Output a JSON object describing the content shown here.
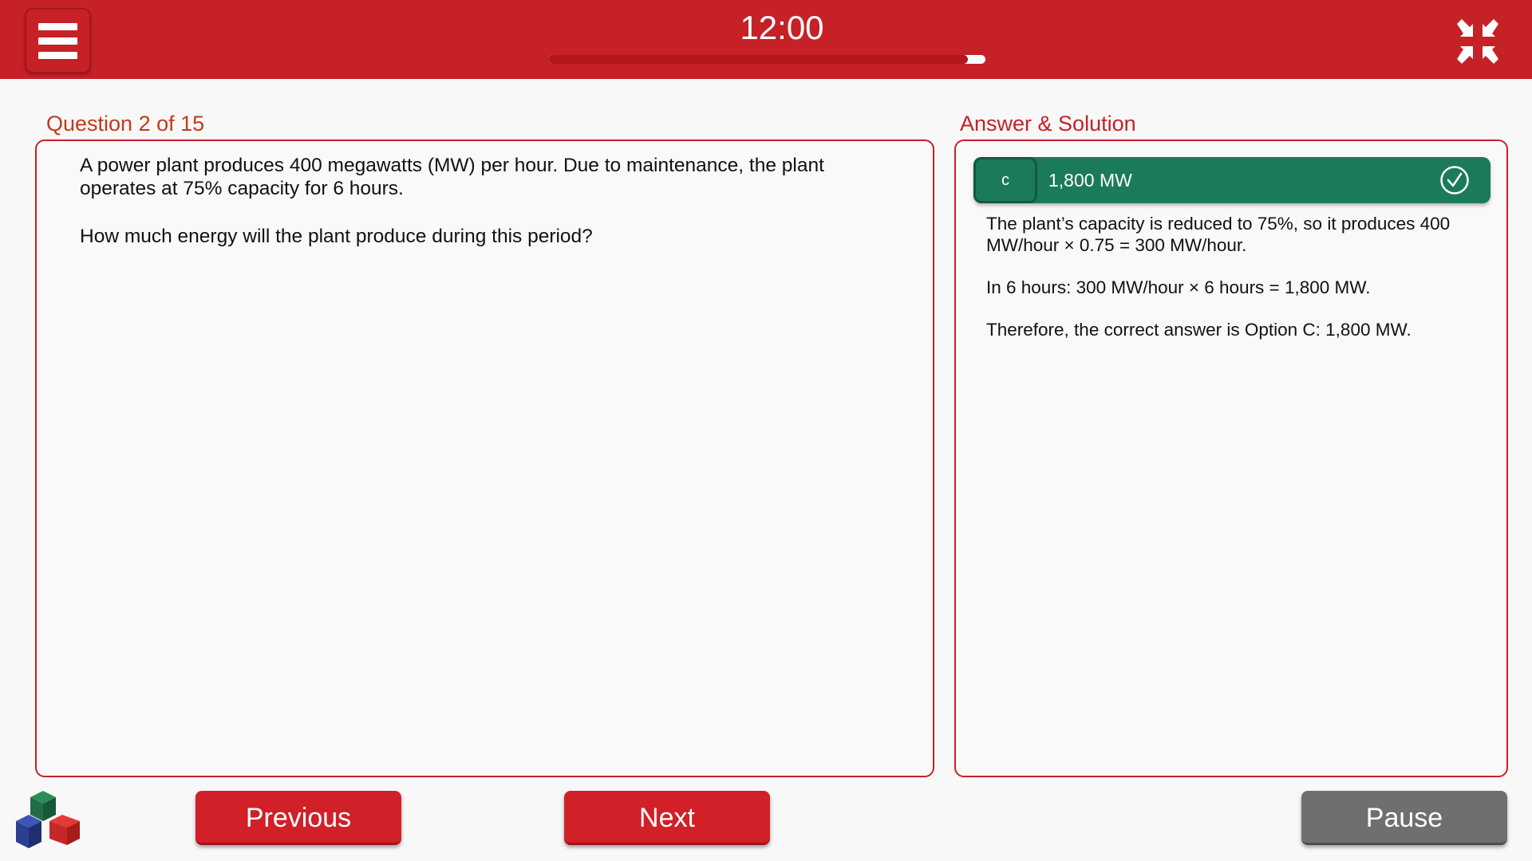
{
  "header": {
    "timer": "12:00",
    "progress": 0.96,
    "menu_icon": "hamburger-menu-icon",
    "fullscreen_icon": "exit-fullscreen-icon"
  },
  "question": {
    "title": "Question 2 of 15",
    "text": "A power plant produces 400 megawatts (MW) per hour. Due to maintenance, the plant operates at 75% capacity for 6 hours.",
    "ask": "How much energy will the plant produce during this period?"
  },
  "answer": {
    "title": "Answer & Solution",
    "letter": "c",
    "text": "1,800 MW",
    "status_icon": "check-circle-icon",
    "solution": [
      "The plant’s capacity is reduced to 75%, so it produces 400 MW/hour × 0.75 = 300 MW/hour.",
      "In 6 hours: 300 MW/hour × 6 hours = 1,800 MW.",
      "Therefore, the correct answer is Option C: 1,800 MW."
    ]
  },
  "footer": {
    "logo_icon": "cubes-logo-icon",
    "previous_label": "Previous",
    "next_label": "Next",
    "pause_label": "Pause"
  },
  "colors": {
    "brand_red": "#c62127",
    "correct_green": "#1b7a5a",
    "pause_gray": "#6f6f6f"
  }
}
